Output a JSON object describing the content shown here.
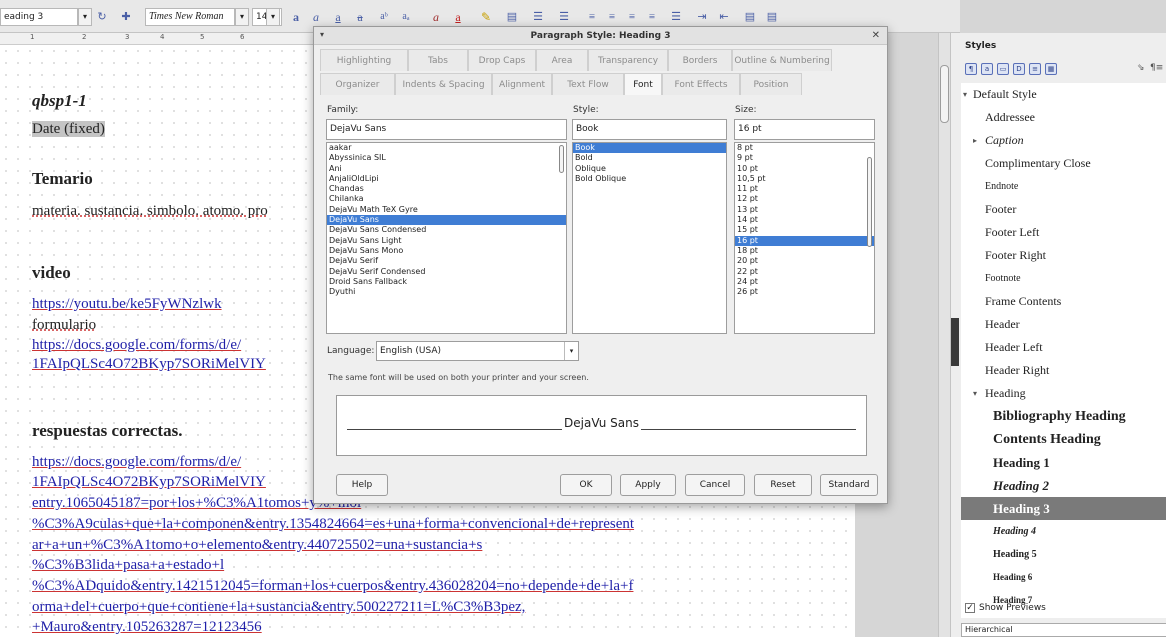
{
  "toolbar": {
    "paragraph_style": "eading 3",
    "font_name": "Times New Roman",
    "font_size": "14"
  },
  "ruler": [
    "1",
    "2",
    "3",
    "4",
    "5",
    "6"
  ],
  "document": {
    "heading_code": "qbsp1-1",
    "date_field": "Date (fixed)",
    "h_temario": "Temario",
    "temario_text": "materia. sustancia. simbolo. atomo. pro",
    "h_video": "video",
    "video_link": "https://youtu.be/ke5FyWNzlwk",
    "formulario": "formulario",
    "form_link_1": "https://docs.google.com/forms/d/e/",
    "form_link_2": "1FAIpQLSc4O72BKyp7SORiMelVIY",
    "h_respuestas": "respuestas correctas.",
    "resp_lines": [
      "https://docs.google.com/forms/d/e/",
      "1FAIpQLSc4O72BKyp7SORiMelVIY",
      "entry.1065045187=por+los+%C3%A1tomos+y%+mol",
      "%C3%A9culas+que+la+componen&entry.1354824664=es+una+forma+convencional+de+represent",
      "ar+a+un+%C3%A1tomo+o+elemento&entry.440725502=una+sustancia+s",
      "%C3%B3lida+pasa+a+estado+l",
      "%C3%ADquido&entry.1421512045=forman+los+cuerpos&entry.436028204=no+depende+de+la+f",
      "orma+del+cuerpo+que+contiene+la+sustancia&entry.500227211=L%C3%B3pez,",
      "+Mauro&entry.105263287=12123456"
    ]
  },
  "dialog": {
    "title": "Paragraph Style: Heading 3",
    "tabs_row1": [
      "Highlighting",
      "Tabs",
      "Drop Caps",
      "Area",
      "Transparency",
      "Borders",
      "Outline & Numbering"
    ],
    "tabs_row2": [
      "Organizer",
      "Indents & Spacing",
      "Alignment",
      "Text Flow",
      "Font",
      "Font Effects",
      "Position"
    ],
    "active_tab": "Font",
    "family_label": "Family:",
    "style_label": "Style:",
    "size_label": "Size:",
    "family_value": "DejaVu Sans",
    "style_value": "Book",
    "size_value": "16 pt",
    "families": [
      "aakar",
      "Abyssinica SIL",
      "Ani",
      "AnjaliOldLipi",
      "Chandas",
      "Chilanka",
      "DejaVu Math TeX Gyre",
      "DejaVu Sans",
      "DejaVu Sans Condensed",
      "DejaVu Sans Light",
      "DejaVu Sans Mono",
      "DejaVu Serif",
      "DejaVu Serif Condensed",
      "Droid Sans Fallback",
      "Dyuthi"
    ],
    "styles": [
      "Book",
      "Bold",
      "Oblique",
      "Bold Oblique"
    ],
    "sizes": [
      "8 pt",
      "9 pt",
      "10 pt",
      "10,5 pt",
      "11 pt",
      "12 pt",
      "13 pt",
      "14 pt",
      "15 pt",
      "16 pt",
      "18 pt",
      "20 pt",
      "22 pt",
      "24 pt",
      "26 pt"
    ],
    "selected_family": "DejaVu Sans",
    "selected_style": "Book",
    "selected_size": "16 pt",
    "language_label": "Language:",
    "language_value": "English (USA)",
    "note": "The same font will be used on both your printer and your screen.",
    "preview_text": "DejaVu Sans",
    "buttons": {
      "help": "Help",
      "ok": "OK",
      "apply": "Apply",
      "cancel": "Cancel",
      "reset": "Reset",
      "standard": "Standard"
    }
  },
  "sidebar": {
    "title": "Styles",
    "items": [
      {
        "label": "Default Style",
        "level": 0,
        "arrow": "▾",
        "font": "plain"
      },
      {
        "label": "Addressee",
        "level": 1,
        "font": "plain"
      },
      {
        "label": "Caption",
        "level": 1,
        "arrow": "▸",
        "font": "italic"
      },
      {
        "label": "Complimentary Close",
        "level": 1,
        "font": "plain"
      },
      {
        "label": "Endnote",
        "level": 1,
        "font": "small"
      },
      {
        "label": "Footer",
        "level": 1,
        "font": "plain"
      },
      {
        "label": "Footer Left",
        "level": 1,
        "font": "plain"
      },
      {
        "label": "Footer Right",
        "level": 1,
        "font": "plain"
      },
      {
        "label": "Footnote",
        "level": 1,
        "font": "small"
      },
      {
        "label": "Frame Contents",
        "level": 1,
        "font": "plain"
      },
      {
        "label": "Header",
        "level": 1,
        "font": "plain"
      },
      {
        "label": "Header Left",
        "level": 1,
        "font": "plain"
      },
      {
        "label": "Header Right",
        "level": 1,
        "font": "plain"
      },
      {
        "label": "Heading",
        "level": 1,
        "arrow": "▾",
        "font": "plain"
      },
      {
        "label": "Bibliography Heading",
        "level": 2,
        "font": "big-bold"
      },
      {
        "label": "Contents Heading",
        "level": 2,
        "font": "big-bold"
      },
      {
        "label": "Heading 1",
        "level": 2,
        "font": "bold"
      },
      {
        "label": "Heading 2",
        "level": 2,
        "font": "bold-italic"
      },
      {
        "label": "Heading 3",
        "level": 2,
        "font": "bold",
        "selected": true
      },
      {
        "label": "Heading 4",
        "level": 2,
        "font": "small-bold-italic"
      },
      {
        "label": "Heading 5",
        "level": 2,
        "font": "small-bold"
      },
      {
        "label": "Heading 6",
        "level": 2,
        "font": "tiny-bold"
      },
      {
        "label": "Heading 7",
        "level": 2,
        "font": "tiny-bold"
      }
    ],
    "show_previews": "Show Previews",
    "filter": "Hierarchical"
  }
}
